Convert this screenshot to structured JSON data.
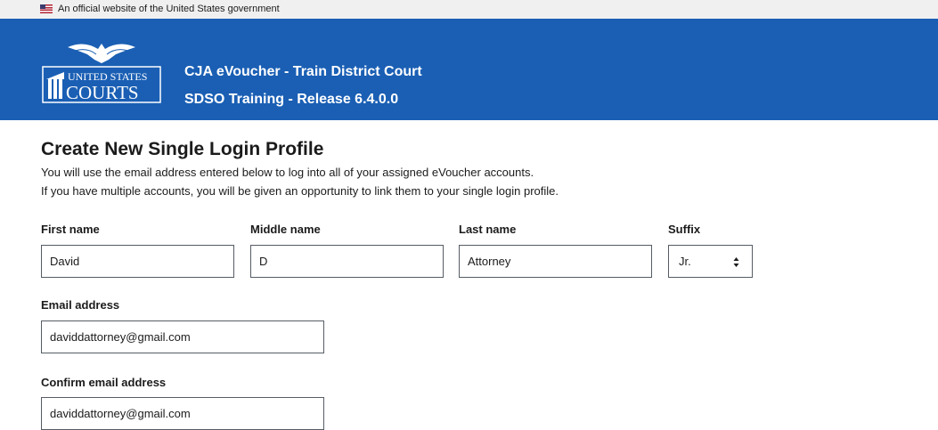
{
  "banner": {
    "text": "An official website of the United States government"
  },
  "header": {
    "logo_text_line1": "UNITED STATES",
    "logo_text_line2": "COURTS",
    "title_line1": "CJA eVoucher - Train District Court",
    "title_line2": "SDSO Training - Release 6.4.0.0"
  },
  "form": {
    "heading": "Create New Single Login Profile",
    "intro_line1": "You will use the email address entered below to log into all of your assigned eVoucher accounts.",
    "intro_line2": "If you have multiple accounts, you will be given an opportunity to link them to your single login profile.",
    "first_name": {
      "label": "First name",
      "value": "David"
    },
    "middle_name": {
      "label": "Middle name",
      "value": "D"
    },
    "last_name": {
      "label": "Last name",
      "value": "Attorney"
    },
    "suffix": {
      "label": "Suffix",
      "value": "Jr."
    },
    "email": {
      "label": "Email address",
      "value": "daviddattorney@gmail.com"
    },
    "confirm_email": {
      "label": "Confirm email address",
      "value": "daviddattorney@gmail.com"
    }
  },
  "colors": {
    "header_bg": "#1a5fb4",
    "banner_bg": "#f0f0f0",
    "field_border": "#565c65"
  },
  "icons": {
    "flag": "us-flag-icon",
    "logo": "us-courts-logo",
    "select": "sort-arrows-icon"
  }
}
